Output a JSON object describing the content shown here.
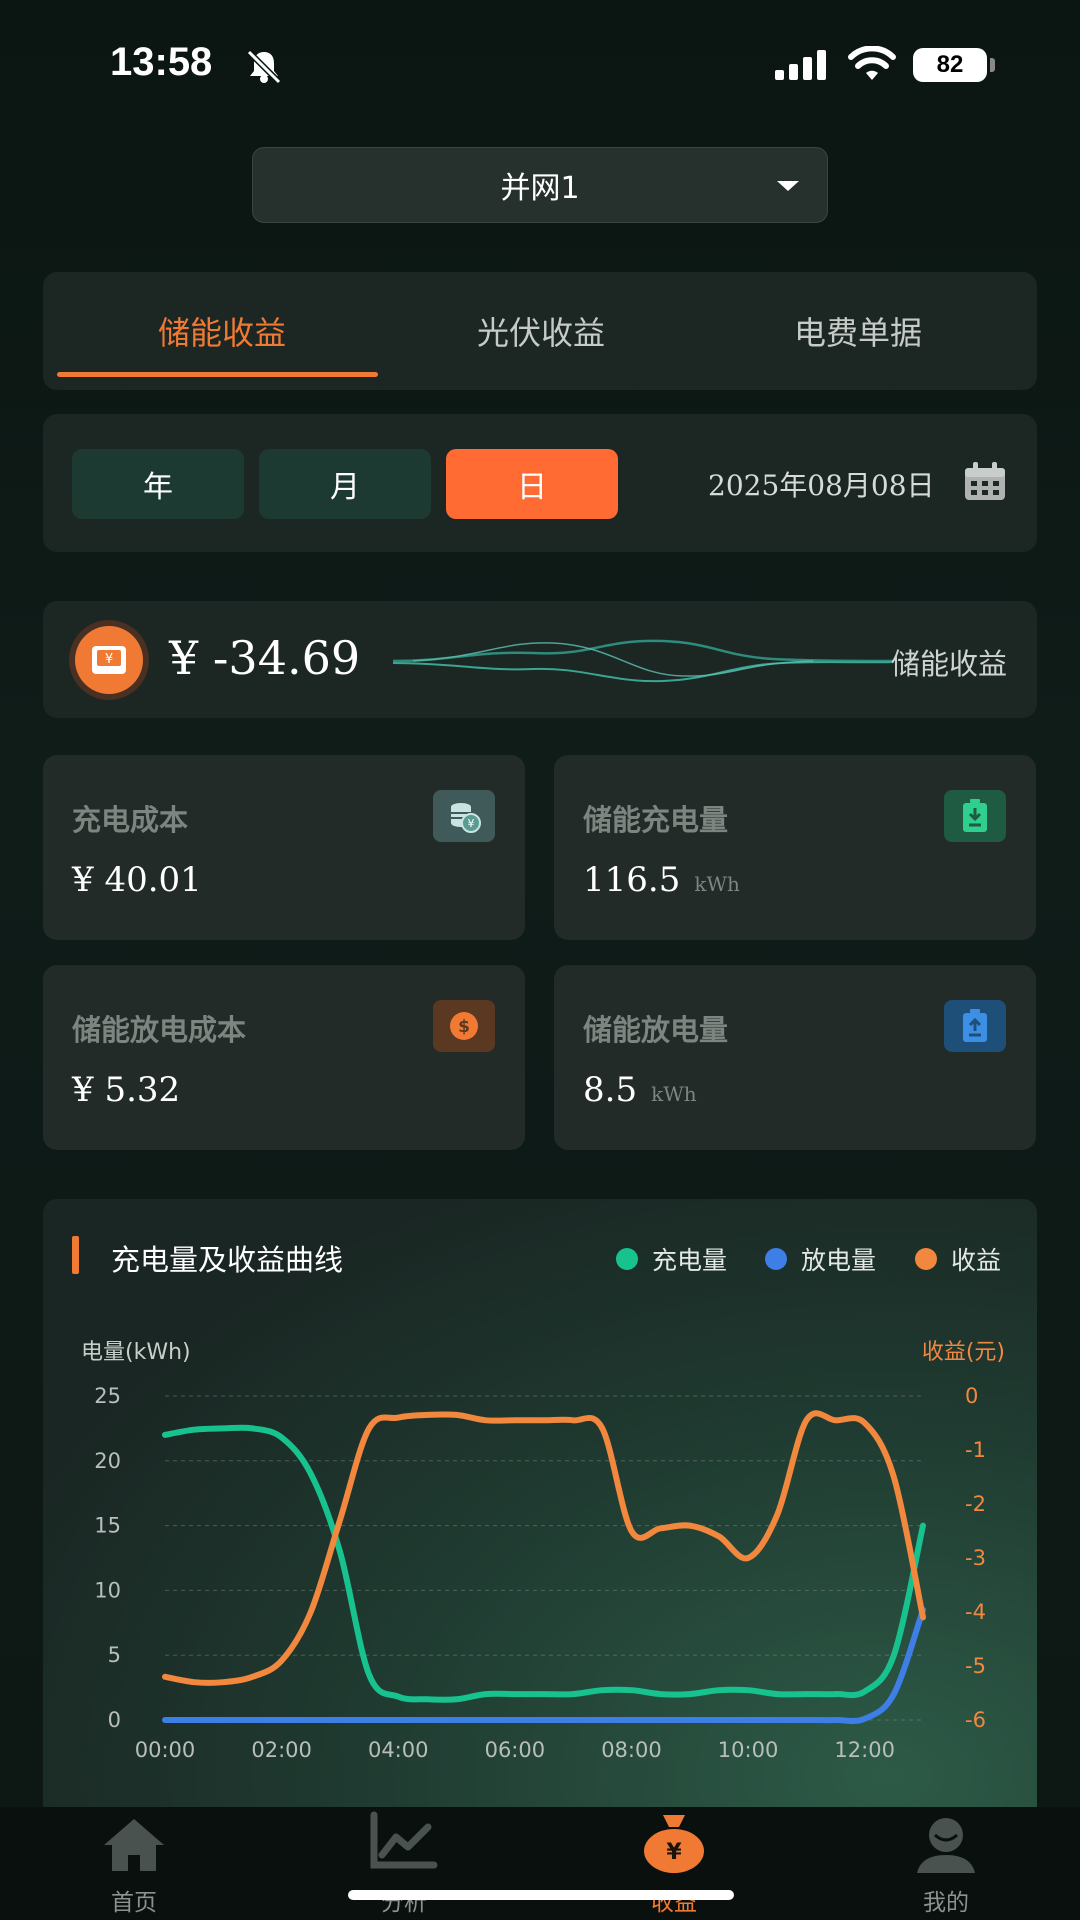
{
  "status": {
    "time": "13:58",
    "battery": "82"
  },
  "selector": {
    "value": "并网1"
  },
  "tabs": [
    {
      "label": "储能收益",
      "active": true
    },
    {
      "label": "光伏收益",
      "active": false
    },
    {
      "label": "电费单据",
      "active": false
    }
  ],
  "period": {
    "buttons": [
      "年",
      "月",
      "日"
    ],
    "active": "日",
    "date": "2025年08月08日"
  },
  "income": {
    "value": "¥ -34.69",
    "label": "储能收益"
  },
  "stats": [
    {
      "title": "充电成本",
      "value": "¥ 40.01",
      "unit": "",
      "icon": "coin-stack-icon",
      "color": "#3f5a59"
    },
    {
      "title": "储能充电量",
      "value": "116.5",
      "unit": "kWh",
      "icon": "battery-charge-icon",
      "color": "#1f5a43"
    },
    {
      "title": "储能放电成本",
      "value": "¥ 5.32",
      "unit": "",
      "icon": "dollar-coin-icon",
      "color": "#5a3822"
    },
    {
      "title": "储能放电量",
      "value": "8.5",
      "unit": "kWh",
      "icon": "battery-discharge-icon",
      "color": "#1d4f78"
    }
  ],
  "chart": {
    "title": "充电量及收益曲线",
    "legend": [
      {
        "name": "充电量",
        "color": "#17c28f"
      },
      {
        "name": "放电量",
        "color": "#3d7fe6"
      },
      {
        "name": "收益",
        "color": "#f2873e"
      }
    ]
  },
  "chart_data": {
    "type": "line",
    "ylabel": "电量(kWh)",
    "ylabel_right": "收益(元)",
    "ylim": [
      0,
      25
    ],
    "ylim_right": [
      -6,
      0
    ],
    "yticks": [
      "25",
      "20",
      "15",
      "10",
      "5",
      "0"
    ],
    "yticks_right": [
      "0",
      "-1",
      "-2",
      "-3",
      "-4",
      "-5",
      "-6"
    ],
    "xticks": [
      "00:00",
      "02:00",
      "04:00",
      "06:00",
      "08:00",
      "10:00",
      "12:00"
    ],
    "x": [
      0,
      0.5,
      1,
      1.5,
      2,
      2.5,
      3,
      3.5,
      4,
      4.5,
      5,
      5.5,
      6,
      6.5,
      7,
      7.5,
      8,
      8.5,
      9,
      9.5,
      10,
      10.5,
      11,
      11.5,
      12,
      12.5,
      13
    ],
    "series": [
      {
        "name": "充电量",
        "axis": "left",
        "color": "#17c28f",
        "values": [
          22,
          22.4,
          22.5,
          22.5,
          21.8,
          19,
          13,
          3.5,
          1.8,
          1.6,
          1.6,
          2,
          2,
          2,
          2,
          2.3,
          2.3,
          2,
          2,
          2.3,
          2.3,
          2,
          2,
          2,
          2.2,
          5,
          15
        ]
      },
      {
        "name": "放电量",
        "axis": "left",
        "color": "#3d7fe6",
        "values": [
          0,
          0,
          0,
          0,
          0,
          0,
          0,
          0,
          0,
          0,
          0,
          0,
          0,
          0,
          0,
          0,
          0,
          0,
          0,
          0,
          0,
          0,
          0,
          0,
          0.1,
          2,
          8.5
        ]
      },
      {
        "name": "收益",
        "axis": "right",
        "color": "#f2873e",
        "values": [
          -5.2,
          -5.3,
          -5.3,
          -5.2,
          -4.9,
          -4.0,
          -2.3,
          -0.6,
          -0.4,
          -0.35,
          -0.35,
          -0.45,
          -0.45,
          -0.45,
          -0.45,
          -0.6,
          -2.5,
          -2.45,
          -2.4,
          -2.6,
          -3.0,
          -2.2,
          -0.45,
          -0.45,
          -0.5,
          -1.5,
          -4.1
        ]
      }
    ]
  },
  "nav": [
    {
      "label": "首页",
      "active": false,
      "icon": "home-icon"
    },
    {
      "label": "分析",
      "active": false,
      "icon": "chart-icon"
    },
    {
      "label": "收益",
      "active": true,
      "icon": "money-bag-icon"
    },
    {
      "label": "我的",
      "active": false,
      "icon": "user-icon"
    }
  ]
}
